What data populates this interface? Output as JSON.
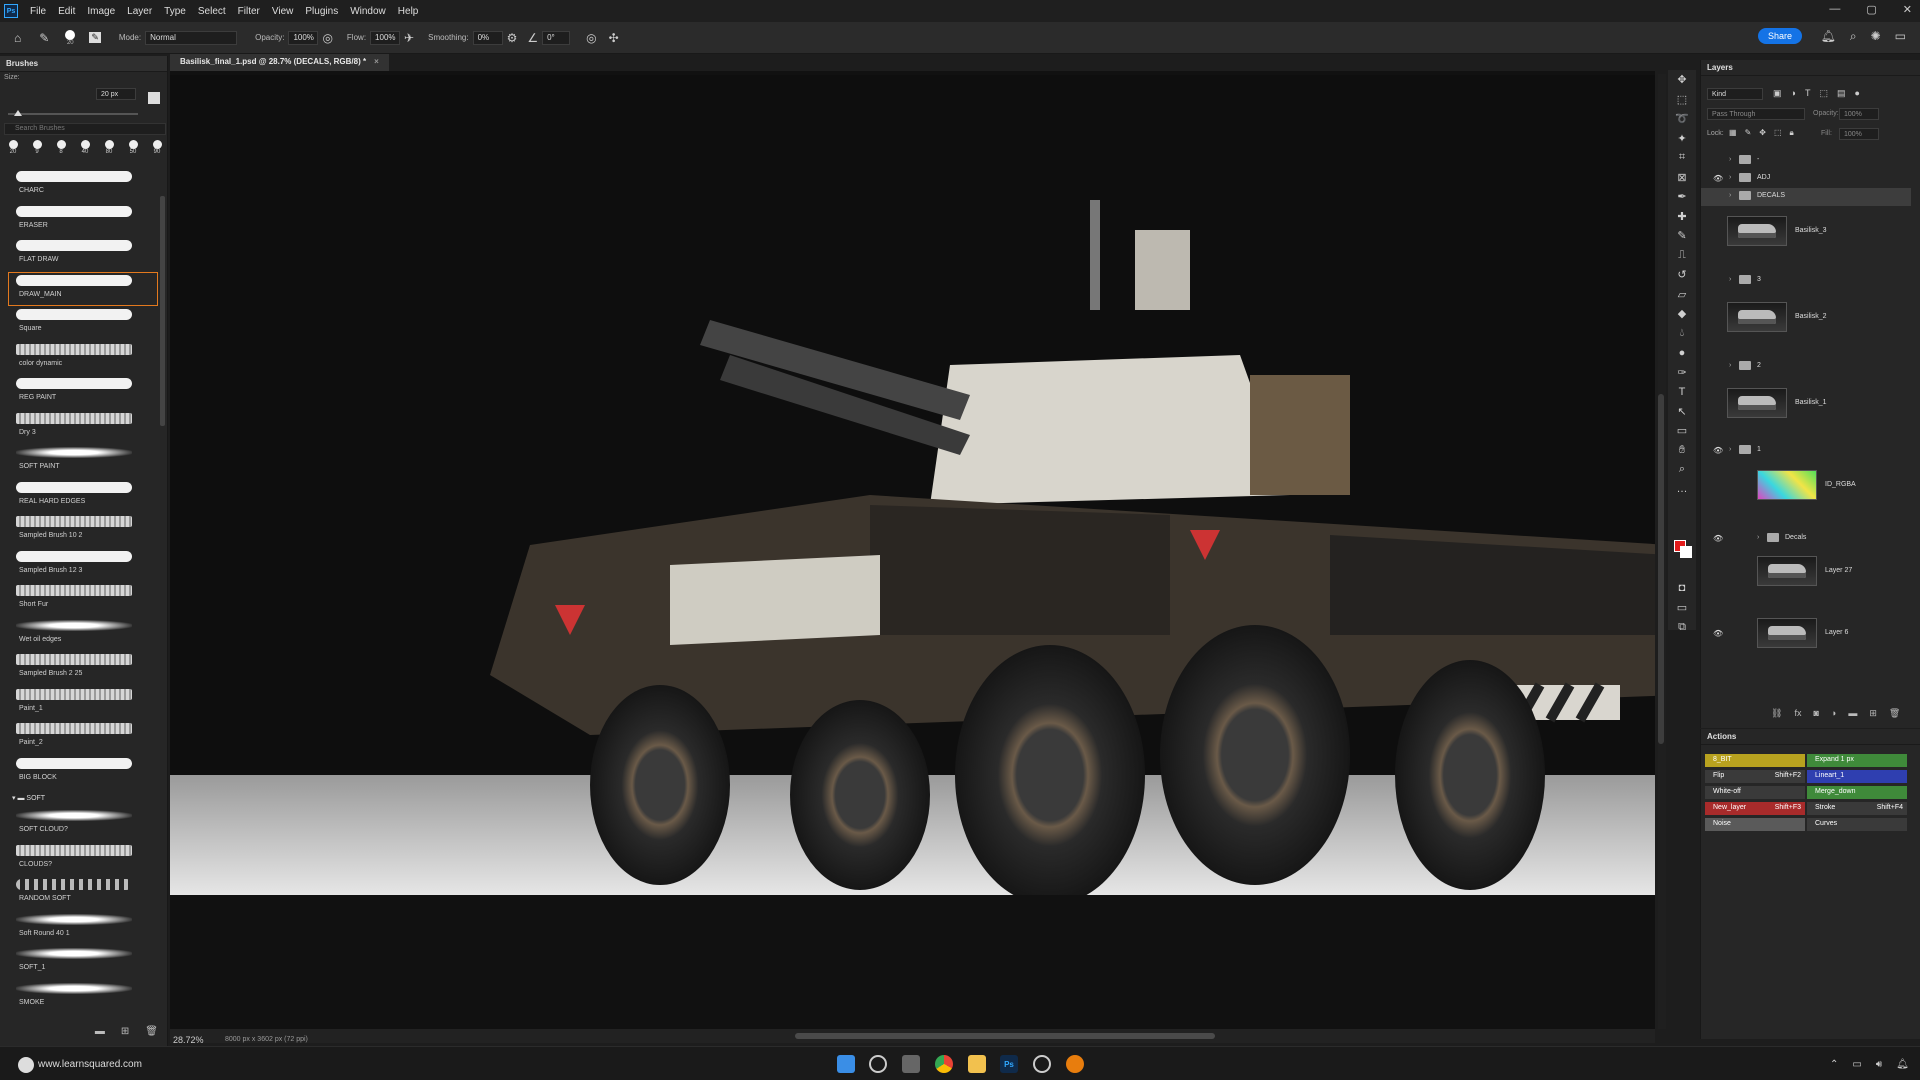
{
  "app": {
    "logo": "Ps"
  },
  "menu": [
    "File",
    "Edit",
    "Image",
    "Layer",
    "Type",
    "Select",
    "Filter",
    "View",
    "Plugins",
    "Window",
    "Help"
  ],
  "window_controls": [
    "—",
    "▢",
    "✕"
  ],
  "options_bar": {
    "brush_size": "20",
    "mode_label": "Mode:",
    "mode_value": "Normal",
    "opacity_label": "Opacity:",
    "opacity_value": "100%",
    "flow_label": "Flow:",
    "flow_value": "100%",
    "smoothing_label": "Smoothing:",
    "smoothing_value": "0%",
    "angle_value": "0°",
    "share_label": "Share"
  },
  "document": {
    "tab_title": "Basilisk_final_1.psd @ 28.7% (DECALS, RGB/8) *",
    "zoom": "28.72%",
    "doc_size": "8000 px x 3602 px (72 ppi)"
  },
  "brushes_panel": {
    "title": "Brushes",
    "size_label": "Size:",
    "size_value": "20 px",
    "search_placeholder": "Search Brushes",
    "recent": [
      "20",
      "9",
      "8",
      "40",
      "80",
      "50",
      "90"
    ],
    "items": [
      {
        "name": "CHARC",
        "style": "solid"
      },
      {
        "name": "ERASER",
        "style": "solid"
      },
      {
        "name": "FLAT DRAW",
        "style": "solid"
      },
      {
        "name": "DRAW_MAIN",
        "style": "solid",
        "selected": true
      },
      {
        "name": "Square",
        "style": "solid"
      },
      {
        "name": "color dynamic",
        "style": "rough"
      },
      {
        "name": "REG PAINT",
        "style": "solid"
      },
      {
        "name": "Dry 3",
        "style": "rough"
      },
      {
        "name": "SOFT PAINT",
        "style": "soft"
      },
      {
        "name": "REAL HARD EDGES",
        "style": "solid"
      },
      {
        "name": "Sampled Brush 10 2",
        "style": "rough"
      },
      {
        "name": "Sampled Brush 12 3",
        "style": "solid"
      },
      {
        "name": "Short Fur",
        "style": "rough"
      },
      {
        "name": "Wet oil edges",
        "style": "soft"
      },
      {
        "name": "Sampled Brush 2 25",
        "style": "rough"
      },
      {
        "name": "Paint_1",
        "style": "rough"
      },
      {
        "name": "Paint_2",
        "style": "rough"
      },
      {
        "name": "BIG BLOCK",
        "style": "solid"
      }
    ],
    "folder_name": "SOFT",
    "soft_items": [
      {
        "name": "SOFT CLOUD?",
        "style": "soft"
      },
      {
        "name": "CLOUDS?",
        "style": "rough"
      },
      {
        "name": "RANDOM SOFT",
        "style": "dots"
      },
      {
        "name": "Soft Round 40 1",
        "style": "soft"
      },
      {
        "name": "SOFT_1",
        "style": "soft"
      },
      {
        "name": "SMOKE",
        "style": "soft"
      }
    ]
  },
  "layers_panel": {
    "title": "Layers",
    "filter_kind": "Kind",
    "blend_mode": "Pass Through",
    "opacity_label": "Opacity:",
    "opacity_value": "100%",
    "lock_label": "Lock:",
    "fill_label": "Fill:",
    "fill_value": "100%",
    "rows": [
      {
        "name": "-",
        "type": "group",
        "visible": false
      },
      {
        "name": "ADJ",
        "type": "group",
        "visible": true
      },
      {
        "name": "DECALS",
        "type": "group",
        "visible": false,
        "selected": true
      },
      {
        "name": "Basilisk_3",
        "type": "layer",
        "visible": false
      },
      {
        "name": "3",
        "type": "group",
        "visible": false
      },
      {
        "name": "Basilisk_2",
        "type": "layer",
        "visible": false
      },
      {
        "name": "2",
        "type": "group",
        "visible": false
      },
      {
        "name": "Basilisk_1",
        "type": "layer",
        "visible": false
      },
      {
        "name": "1",
        "type": "group",
        "visible": true
      },
      {
        "name": "ID_RGBA",
        "type": "layer",
        "visible": false,
        "thumb": "id"
      },
      {
        "name": "Decals",
        "type": "group",
        "visible": true
      },
      {
        "name": "Layer 27",
        "type": "layer",
        "visible": false
      },
      {
        "name": "Layer 6",
        "type": "layer",
        "visible": true
      }
    ]
  },
  "actions_panel": {
    "title": "Actions",
    "items": [
      {
        "label": "8_BIT",
        "shortcut": "",
        "color": "#b8a21f"
      },
      {
        "label": "Expand 1 px",
        "shortcut": "",
        "color": "#3f8a3a"
      },
      {
        "label": "Flip",
        "shortcut": "Shift+F2",
        "color": "#3a3a3a"
      },
      {
        "label": "Lineart_1",
        "shortcut": "",
        "color": "#2f3fb0"
      },
      {
        "label": "White-off",
        "shortcut": "",
        "color": "#3a3a3a"
      },
      {
        "label": "Merge_down",
        "shortcut": "",
        "color": "#3f8a3a"
      },
      {
        "label": "New_layer",
        "shortcut": "Shift+F3",
        "color": "#a82b2b"
      },
      {
        "label": "Stroke",
        "shortcut": "Shift+F4",
        "color": "#3a3a3a"
      },
      {
        "label": "Noise",
        "shortcut": "",
        "color": "#5a5a5a"
      },
      {
        "label": "Curves",
        "shortcut": "",
        "color": "#3a3a3a"
      }
    ]
  },
  "taskbar": {
    "watermark": "www.learnsquared.com"
  }
}
